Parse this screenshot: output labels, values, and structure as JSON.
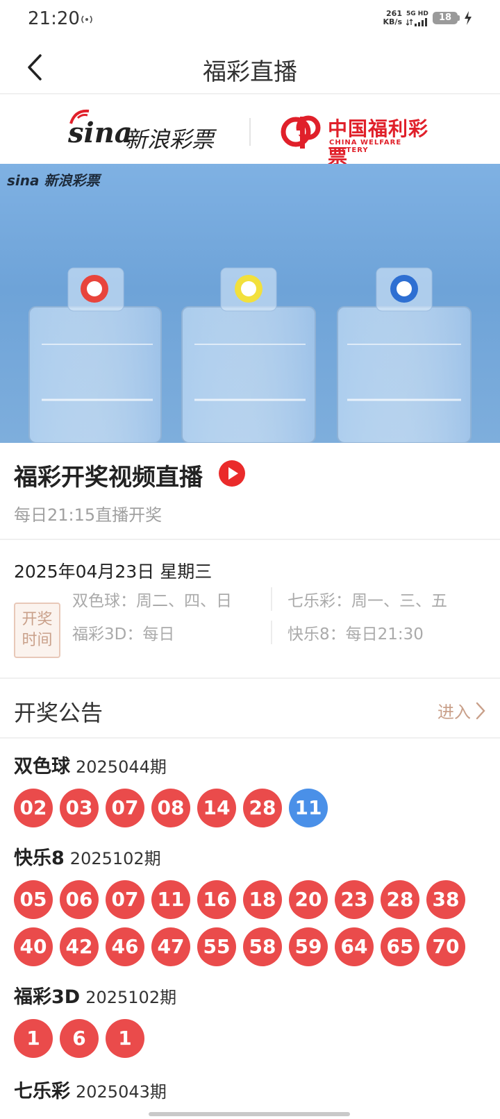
{
  "status_bar": {
    "time": "21:20",
    "net_speed_value": "261",
    "net_speed_unit": "KB/s",
    "net_type": "5G HD",
    "battery": "18"
  },
  "nav": {
    "title": "福彩直播"
  },
  "brand": {
    "sina_wordmark": "sina",
    "sina_name": "新浪彩票",
    "cwl_name": "中国福利彩票",
    "cwl_english": "CHINA WELFARE LOTTERY"
  },
  "video": {
    "watermark": "sina 新浪彩票"
  },
  "live": {
    "title": "福彩开奖视频直播",
    "subtitle": "每日21:15直播开奖"
  },
  "schedule": {
    "date": "2025年04月23日 星期三",
    "badge_line1": "开奖",
    "badge_line2": "时间",
    "items": [
      "双色球：周二、四、日",
      "七乐彩：周一、三、五",
      "福彩3D：每日",
      "快乐8：每日21:30"
    ]
  },
  "announcements": {
    "title": "开奖公告",
    "enter_label": "进入",
    "lotteries": [
      {
        "name": "双色球",
        "issue": "2025044期",
        "red": [
          "02",
          "03",
          "07",
          "08",
          "14",
          "28"
        ],
        "blue": [
          "11"
        ]
      },
      {
        "name": "快乐8",
        "issue": "2025102期",
        "red": [
          "05",
          "06",
          "07",
          "11",
          "16",
          "18",
          "20",
          "23",
          "28",
          "38",
          "40",
          "42",
          "46",
          "47",
          "55",
          "58",
          "59",
          "64",
          "65",
          "70"
        ],
        "blue": []
      },
      {
        "name": "福彩3D",
        "issue": "2025102期",
        "red": [
          "1",
          "6",
          "1"
        ],
        "blue": []
      },
      {
        "name": "七乐彩",
        "issue": "2025043期",
        "red": [],
        "blue": []
      }
    ]
  },
  "colors": {
    "red_ball": "#ea4b4b",
    "blue_ball": "#4a90e8",
    "brand_red": "#e0202a",
    "badge_text": "#c9a08a"
  }
}
